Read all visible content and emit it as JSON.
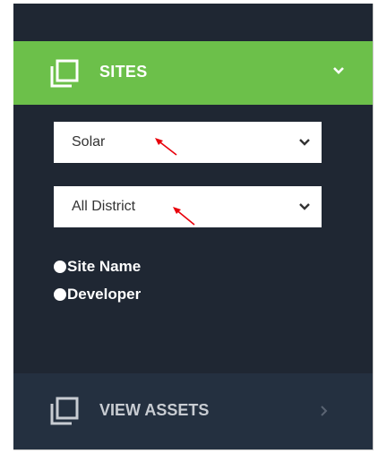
{
  "sites_section": {
    "title": "SITES",
    "icon": "copy-icon",
    "toggle_icon": "chevron-down-icon",
    "accent_color": "#6cc04a"
  },
  "filters": {
    "type_select": {
      "value": "Solar",
      "icon": "chevron-down-icon"
    },
    "district_select": {
      "value": "All District",
      "icon": "chevron-down-icon"
    },
    "radio_options": [
      {
        "label": "Site Name"
      },
      {
        "label": "Developer"
      }
    ],
    "annotation_arrow_color": "#e8000b"
  },
  "view_assets_section": {
    "title": "VIEW ASSETS",
    "icon": "copy-icon",
    "toggle_icon": "chevron-right-icon"
  }
}
